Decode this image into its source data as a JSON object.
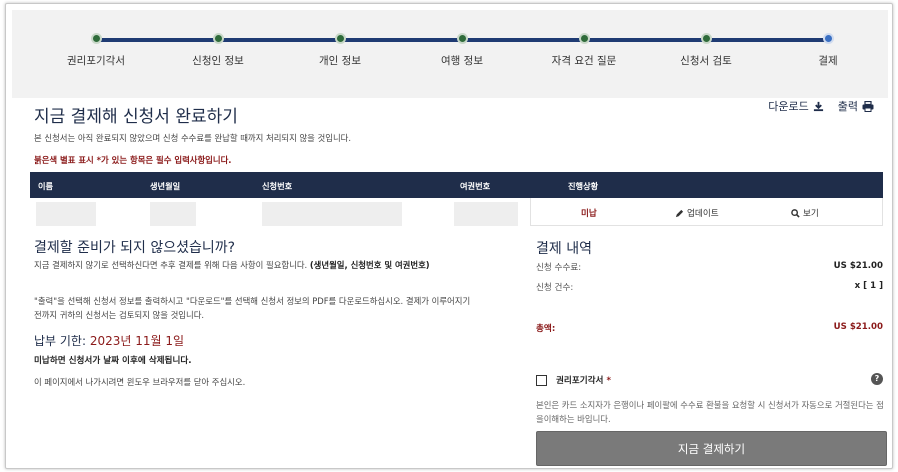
{
  "steps": [
    {
      "label": "권리포기각서"
    },
    {
      "label": "신청인 정보"
    },
    {
      "label": "개인 정보"
    },
    {
      "label": "여행 정보"
    },
    {
      "label": "자격 요건 질문"
    },
    {
      "label": "신청서 검토"
    },
    {
      "label": "결제"
    }
  ],
  "header": {
    "title": "지금 결제해 신청서 완료하기",
    "download": "다운로드",
    "print": "출력",
    "description": "본 신청서는 아직 완료되지 않았으며 신청 수수료를 완납할 때까지 처리되지 않을 것입니다.",
    "required_note": "붉은색 별표 표시 *가 있는 항목은 필수 입력사항입니다."
  },
  "table": {
    "columns": [
      "이름",
      "생년월일",
      "신청번호",
      "여권번호",
      "진행상황"
    ],
    "row": {
      "status": "미납",
      "update": "업데이트",
      "view": "보기"
    }
  },
  "left": {
    "title": "결제할 준비가 되지 않으셨습니까?",
    "p1_pre": "지금 결제하지 않기로 선택하신다면 추후 결제를 위해 다음 사항이 필요합니다.",
    "p1_bold": "(생년월일, 신청번호 및 여권번호)",
    "p2": "\"출력\"을 선택해 신청서 정보를 출력하시고 \"다운로드\"를 선택해 신청서 정보의 PDF를 다운로드하십시오. 결제가 이루어지기 전까지 귀하의 신청서는 검토되지 않을 것입니다.",
    "deadline_label": "납부 기한:",
    "deadline_date": "2023년 11월 1일",
    "warning": "미납하면 신청서가 날짜 이후에 삭제됩니다.",
    "leave": "이 페이지에서 나가시려면 윈도우 브라우저를 닫아 주십시오."
  },
  "right": {
    "title": "결제 내역",
    "fee_label": "신청 수수료:",
    "fee_value": "US $21.00",
    "count_label": "신청 건수:",
    "count_value": "x [ 1 ]",
    "total_label": "총액:",
    "total_value": "US $21.00",
    "ack_label": "권리포기각서",
    "ack_star": "*",
    "ack_text": "본인은 카드 소지자가 은행이나 페이팔에 수수료 환불을 요청할 시 신청서가 자동으로 거절된다는 점을이해하는 바입니다.",
    "pay_button": "지금 결제하기"
  }
}
